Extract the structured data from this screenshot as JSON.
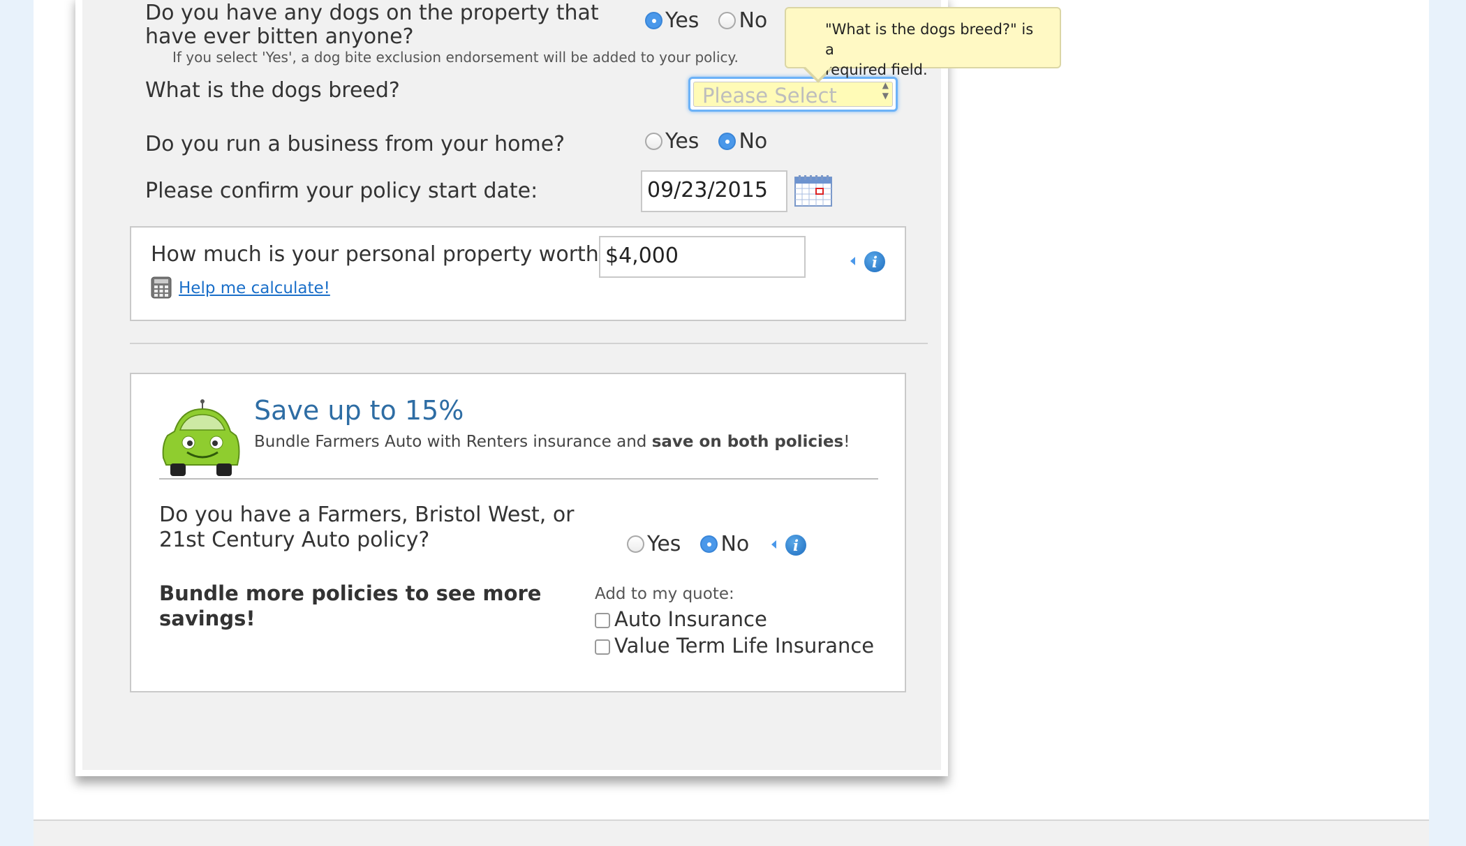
{
  "dogs_bitten": {
    "question_line1": "Do you have any dogs on the property that",
    "question_line2": "have ever bitten anyone?",
    "note": "If you select 'Yes', a dog bite exclusion endorsement will be added to your policy.",
    "options": [
      "Yes",
      "No"
    ],
    "selected": "Yes"
  },
  "tooltip": {
    "line1": "\"What is the dogs breed?\" is a",
    "line2": "required field."
  },
  "dog_breed": {
    "question": "What is the dogs breed?",
    "placeholder": "Please Select"
  },
  "business": {
    "question": "Do you run a business from your home?",
    "options": [
      "Yes",
      "No"
    ],
    "selected": "No"
  },
  "start_date": {
    "question": "Please confirm your policy start date:",
    "value": "09/23/2015"
  },
  "property": {
    "question": "How much is your personal property worth?",
    "value": "$4,000",
    "help_link": "Help me calculate!"
  },
  "bundle": {
    "title": "Save up to 15%",
    "subtitle_pre": "Bundle Farmers Auto with Renters insurance and ",
    "subtitle_bold": "save on both policies",
    "subtitle_post": "!",
    "auto_question_line1": "Do you have a Farmers, Bristol West, or",
    "auto_question_line2": "21st Century Auto policy?",
    "auto_options": [
      "Yes",
      "No"
    ],
    "auto_selected": "No",
    "more_line1": "Bundle more policies to see more",
    "more_line2": "savings!",
    "add_label": "Add to my quote:",
    "checkboxes": [
      "Auto Insurance",
      "Value Term Life Insurance"
    ]
  },
  "colors": {
    "accent_blue": "#4a98ea",
    "title_blue": "#2e6da4",
    "tooltip_yellow": "#fff9c4",
    "car_green": "#8fcd2f"
  }
}
